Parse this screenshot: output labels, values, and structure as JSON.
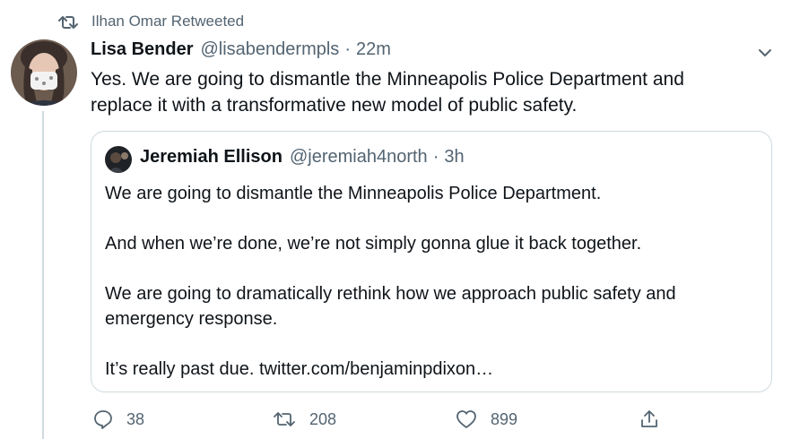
{
  "retweet_context": {
    "text": "Ilhan Omar Retweeted",
    "icon": "retweet-icon"
  },
  "tweet": {
    "author_name": "Lisa Bender",
    "author_handle": "@lisabendermpls",
    "separator": "·",
    "time": "22m",
    "text_line1": "Yes. We are going to dismantle the Minneapolis Police Department and",
    "text_line2": "replace it with a transformative new model of public safety.",
    "menu_icon": "chevron-down-icon"
  },
  "quote": {
    "author_name": "Jeremiah Ellison",
    "author_handle": "@jeremiah4north",
    "separator": "·",
    "time": "3h",
    "paragraphs": [
      "We are going to dismantle the Minneapolis Police Department.",
      "And when we’re done, we’re not simply gonna glue it back together.",
      "We are going to dramatically rethink how we approach public safety and emergency response.",
      "It’s really past due. twitter.com/benjaminpdixon…"
    ]
  },
  "actions": {
    "replies": "38",
    "retweets": "208",
    "likes": "899",
    "share_icon": "share-icon"
  },
  "colors": {
    "text": "#0f1419",
    "secondary": "#536471",
    "border": "#cfd9de"
  }
}
